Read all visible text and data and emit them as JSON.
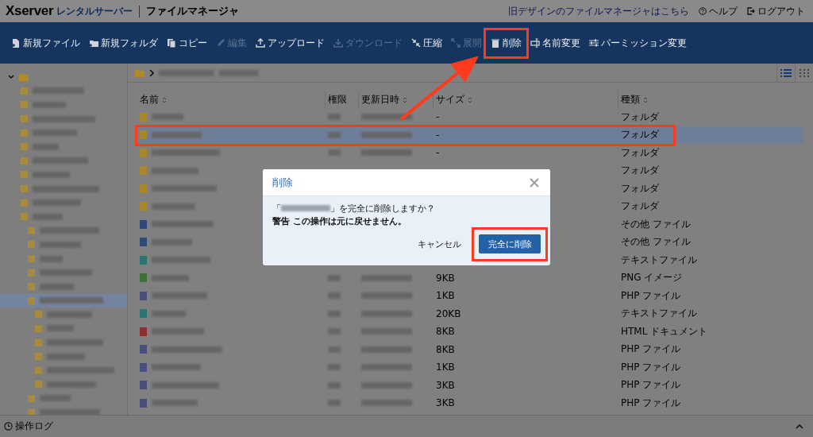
{
  "header": {
    "brand": "Xserver",
    "brand_sub": "レンタルサーバー",
    "app_title": "ファイルマネージャ",
    "links": [
      {
        "label": "旧デザインのファイルマネージャはこちら",
        "kind": "plain"
      },
      {
        "label": "ヘルプ",
        "kind": "help"
      },
      {
        "label": "ログアウト",
        "kind": "logout"
      }
    ]
  },
  "toolbar": [
    {
      "label": "新規ファイル",
      "kind": "new-file",
      "disabled": false,
      "highlighted": false
    },
    {
      "label": "新規フォルダ",
      "kind": "new-folder",
      "disabled": false,
      "highlighted": false
    },
    {
      "label": "コピー",
      "kind": "copy",
      "disabled": false,
      "highlighted": false
    },
    {
      "label": "編集",
      "kind": "edit",
      "disabled": true,
      "highlighted": false
    },
    {
      "label": "アップロード",
      "kind": "upload",
      "disabled": false,
      "highlighted": false
    },
    {
      "label": "ダウンロード",
      "kind": "download",
      "disabled": true,
      "highlighted": false
    },
    {
      "label": "圧縮",
      "kind": "compress",
      "disabled": false,
      "highlighted": false
    },
    {
      "label": "展開",
      "kind": "expand",
      "disabled": true,
      "highlighted": false
    },
    {
      "label": "削除",
      "kind": "delete",
      "disabled": false,
      "highlighted": true
    },
    {
      "label": "名前変更",
      "kind": "rename",
      "disabled": false,
      "highlighted": false
    },
    {
      "label": "パーミッション変更",
      "kind": "permission",
      "disabled": false,
      "highlighted": false
    }
  ],
  "sidebar": {
    "root": {
      "expanded": true
    },
    "items": [
      {
        "selected": false
      },
      {
        "selected": false
      },
      {
        "selected": false
      },
      {
        "selected": false
      },
      {
        "selected": false
      },
      {
        "selected": false
      },
      {
        "selected": false
      },
      {
        "selected": false
      },
      {
        "selected": false
      },
      {
        "selected": false,
        "children": [
          {
            "selected": false
          },
          {
            "selected": false
          },
          {
            "selected": false
          },
          {
            "selected": false
          },
          {
            "selected": false
          },
          {
            "selected": true,
            "children": [
              {
                "selected": false
              },
              {
                "selected": false
              },
              {
                "selected": false
              },
              {
                "selected": false
              },
              {
                "selected": false
              },
              {
                "selected": false
              }
            ]
          },
          {
            "selected": false
          },
          {
            "selected": false
          }
        ]
      }
    ]
  },
  "view_modes": [
    {
      "kind": "list",
      "selected": true
    },
    {
      "kind": "grid",
      "selected": false
    }
  ],
  "table": {
    "columns": [
      "名前",
      "権限",
      "更新日時",
      "サイズ",
      "種類"
    ],
    "rows": [
      {
        "kind": "folder",
        "selected": false,
        "highlighted": false,
        "size": "-",
        "type": "フォルダ"
      },
      {
        "kind": "folder",
        "selected": true,
        "highlighted": true,
        "size": "-",
        "type": "フォルダ"
      },
      {
        "kind": "folder",
        "selected": false,
        "highlighted": false,
        "size": "-",
        "type": "フォルダ"
      },
      {
        "kind": "folder",
        "selected": false,
        "highlighted": false,
        "type": "フォルダ"
      },
      {
        "kind": "folder",
        "selected": false,
        "highlighted": false,
        "type": "フォルダ"
      },
      {
        "kind": "folder",
        "selected": false,
        "highlighted": false,
        "type": "フォルダ"
      },
      {
        "kind": "other",
        "selected": false,
        "highlighted": false,
        "type": "その他 ファイル"
      },
      {
        "kind": "other",
        "selected": false,
        "highlighted": false,
        "type": "その他 ファイル"
      },
      {
        "kind": "text",
        "selected": false,
        "highlighted": false,
        "type": "テキストファイル"
      },
      {
        "kind": "image",
        "selected": false,
        "highlighted": false,
        "size": "9KB",
        "type": "PNG イメージ"
      },
      {
        "kind": "php",
        "selected": false,
        "highlighted": false,
        "size": "1KB",
        "type": "PHP ファイル"
      },
      {
        "kind": "text",
        "selected": false,
        "highlighted": false,
        "size": "20KB",
        "type": "テキストファイル"
      },
      {
        "kind": "html",
        "selected": false,
        "highlighted": false,
        "size": "8KB",
        "type": "HTML ドキュメント"
      },
      {
        "kind": "php",
        "selected": false,
        "highlighted": false,
        "size": "8KB",
        "type": "PHP ファイル"
      },
      {
        "kind": "php",
        "selected": false,
        "highlighted": false,
        "size": "1KB",
        "type": "PHP ファイル"
      },
      {
        "kind": "php",
        "selected": false,
        "highlighted": false,
        "size": "3KB",
        "type": "PHP ファイル"
      },
      {
        "kind": "php",
        "selected": false,
        "highlighted": false,
        "size": "3KB",
        "type": "PHP ファイル"
      }
    ]
  },
  "dialog": {
    "title": "削除",
    "message_before": "「",
    "message_after": "」を完全に削除しますか？",
    "warning": "警告 この操作は元に戻せません。",
    "cancel": "キャンセル",
    "confirm": "完全に削除",
    "confirm_highlighted": true
  },
  "bottom_bar": {
    "label": "操作ログ"
  }
}
